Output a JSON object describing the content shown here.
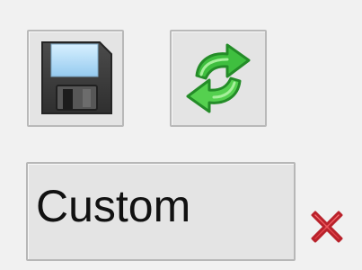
{
  "toolbar": {
    "save_icon": "floppy-disk-icon",
    "refresh_icon": "refresh-arrows-icon"
  },
  "preset": {
    "label": "Custom",
    "remove_icon": "red-x-icon"
  },
  "colors": {
    "background": "#f1f1f1",
    "button_face": "#e4e4e4",
    "button_border": "#b9b9b9",
    "refresh_green": "#3fbf3f",
    "remove_red": "#e2434b"
  }
}
